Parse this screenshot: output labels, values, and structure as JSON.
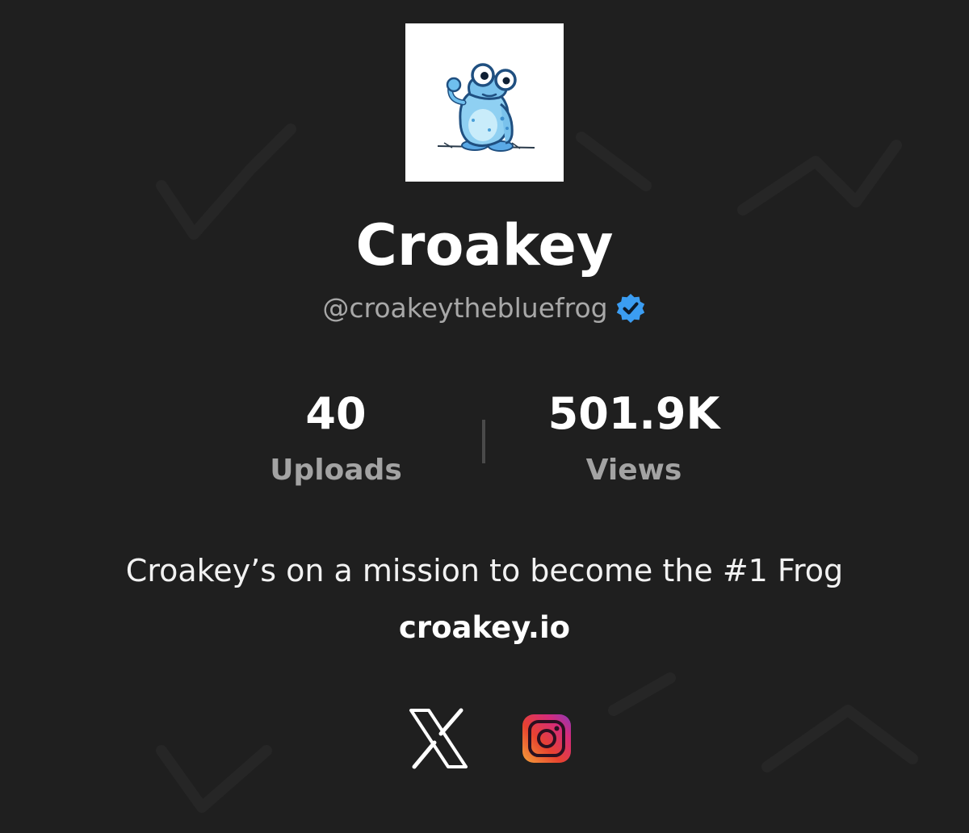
{
  "profile": {
    "display_name": "Croakey",
    "handle": "@croakeythebluefrog",
    "verified": true,
    "avatar_icon": "blue-frog-avatar"
  },
  "stats": [
    {
      "value": "40",
      "label": "Uploads"
    },
    {
      "value": "501.9K",
      "label": "Views"
    }
  ],
  "bio": "Croakey’s on a mission to become the #1 Frog",
  "website": "croakey.io",
  "socials": [
    {
      "icon": "x-icon"
    },
    {
      "icon": "instagram-icon"
    }
  ],
  "colors": {
    "background": "#1f1f1f",
    "muted_text": "#a8a8a8",
    "verified_badge": "#3b9df2"
  }
}
